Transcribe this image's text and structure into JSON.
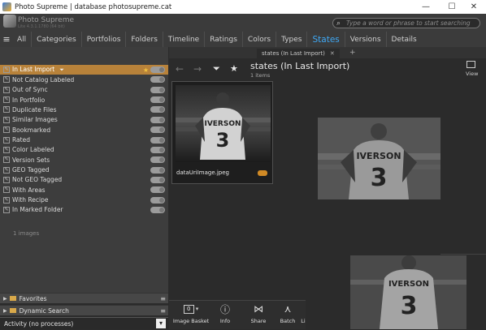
{
  "window": {
    "title": "Photo Supreme | database photosupreme.cat",
    "minimize": "—",
    "maximize": "☐",
    "close": "✕"
  },
  "app": {
    "name": "Photo Supreme",
    "version": "Lite 4.3.1.1780 (64 bit)"
  },
  "search": {
    "placeholder": "Type a word or phrase to start searching"
  },
  "tabs": [
    {
      "label": "All"
    },
    {
      "label": "Categories"
    },
    {
      "label": "Portfolios"
    },
    {
      "label": "Folders"
    },
    {
      "label": "Timeline"
    },
    {
      "label": "Ratings"
    },
    {
      "label": "Colors"
    },
    {
      "label": "Types"
    },
    {
      "label": "States",
      "active": true
    },
    {
      "label": "Versions"
    },
    {
      "label": "Details"
    }
  ],
  "states": {
    "items": [
      {
        "label": "In Last Import",
        "selected": true
      },
      {
        "label": "Not Catalog Labeled"
      },
      {
        "label": "Out of Sync"
      },
      {
        "label": "In Portfolio"
      },
      {
        "label": "Duplicate Files"
      },
      {
        "label": "Similar Images"
      },
      {
        "label": "Bookmarked"
      },
      {
        "label": "Rated"
      },
      {
        "label": "Color Labeled"
      },
      {
        "label": "Version Sets"
      },
      {
        "label": "GEO Tagged"
      },
      {
        "label": "Not GEO Tagged"
      },
      {
        "label": "With Areas"
      },
      {
        "label": "With Recipe"
      },
      {
        "label": "In Marked Folder"
      }
    ],
    "count_text": "1 images"
  },
  "sections": {
    "favorites": "Favorites",
    "dynamic_search": "Dynamic Search"
  },
  "status": {
    "activity": "Activity (no processes)"
  },
  "workspace": {
    "tab_label": "states (In Last Import)",
    "title": "states (In Last Import)",
    "subtitle": "1 items",
    "view_label": "View"
  },
  "thumbnail": {
    "filename": "dataUriImage.jpeg",
    "jersey_name": "IVERSON",
    "jersey_number": "3"
  },
  "bottom": {
    "image_basket": "Image Basket",
    "basket_count": "0",
    "info": "Info",
    "share": "Share",
    "batch": "Batch",
    "more": "Li"
  },
  "colors": {
    "accent": "#3fa9f5",
    "selection": "#b8823a",
    "rating": "#d08a25"
  }
}
